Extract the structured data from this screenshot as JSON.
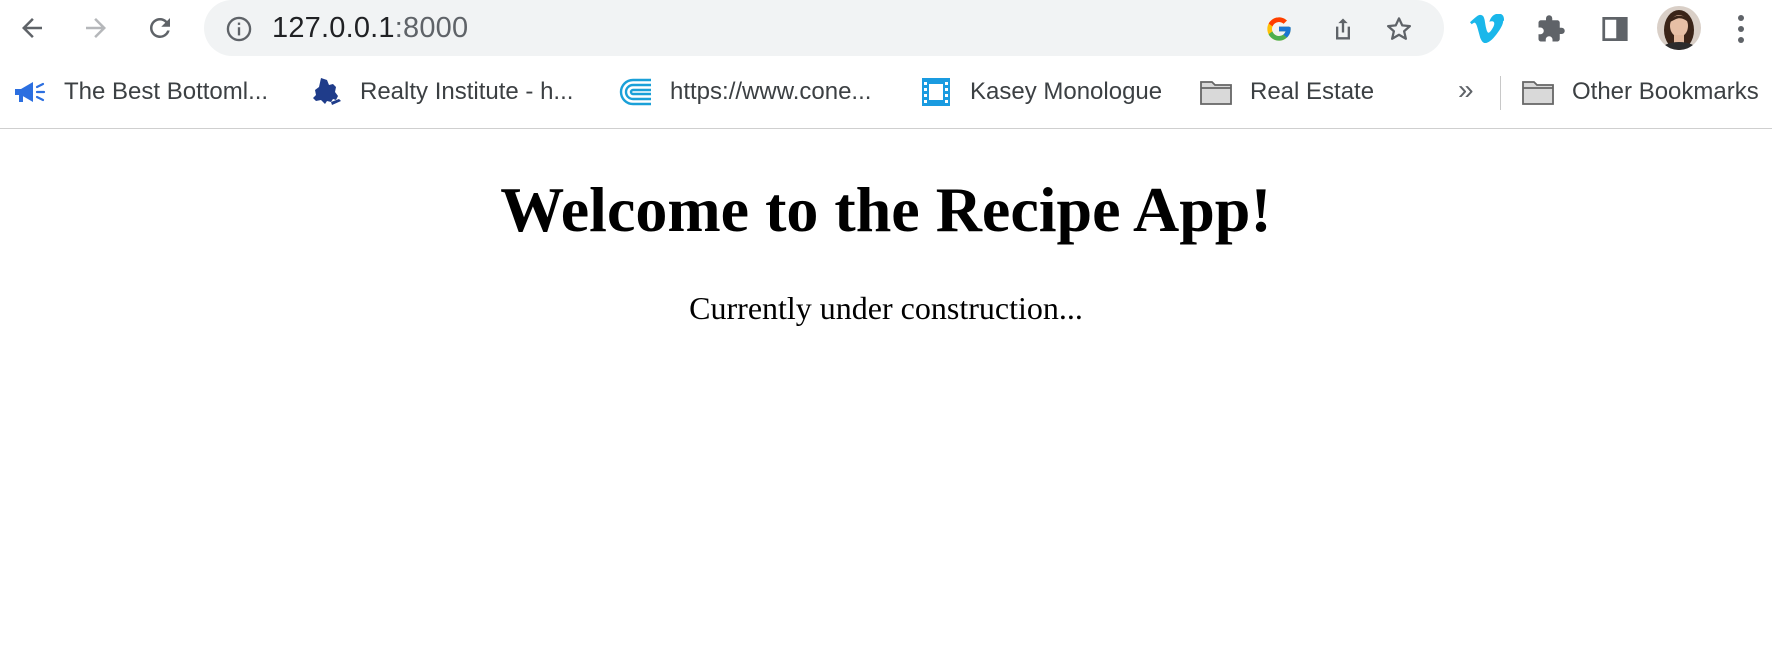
{
  "browser": {
    "url_host": "127.0.0.1",
    "url_port": ":8000"
  },
  "bookmarks": [
    {
      "label": "The Best Bottoml...",
      "icon": "megaphone-icon"
    },
    {
      "label": "Realty Institute - h...",
      "icon": "new-york-state-icon"
    },
    {
      "label": "https://www.cone...",
      "icon": "cone-logo-icon"
    },
    {
      "label": "Kasey Monologue",
      "icon": "film-icon"
    },
    {
      "label": "Real Estate",
      "icon": "folder-icon"
    }
  ],
  "bookmarks_overflow": "»",
  "other_bookmarks": {
    "label": "Other Bookmarks",
    "icon": "folder-icon"
  },
  "page": {
    "heading": "Welcome to the Recipe App!",
    "subtext": "Currently under construction..."
  },
  "colors": {
    "omnibox_bg": "#f1f3f4",
    "vimeo_blue": "#1ab7ea",
    "icon_gray": "#5f6368"
  }
}
